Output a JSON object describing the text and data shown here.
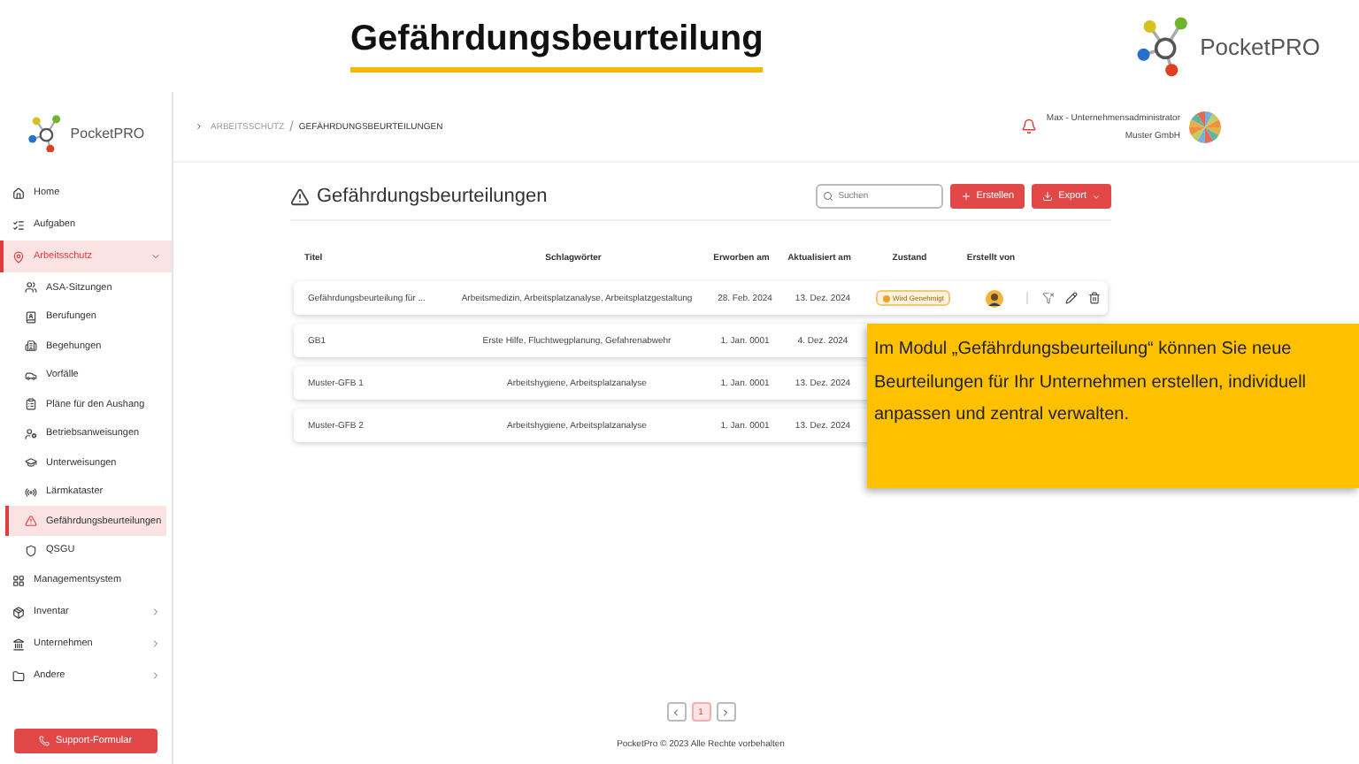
{
  "banner": {
    "title": "Gefährdungsbeurteilung",
    "logo_text": "PocketPRO"
  },
  "sidebar": {
    "logo_text": "PocketPRO",
    "items": [
      {
        "label": "Home",
        "selected": false
      },
      {
        "label": "Aufgaben",
        "selected": false
      },
      {
        "label": "Arbeitsschutz",
        "selected": true,
        "expanded": true,
        "children": [
          {
            "label": "ASA-Sitzungen",
            "selected": false
          },
          {
            "label": "Berufungen",
            "selected": false
          },
          {
            "label": "Begehungen",
            "selected": false
          },
          {
            "label": "Vorfälle",
            "selected": false
          },
          {
            "label": "Pläne für den Aushang",
            "selected": false
          },
          {
            "label": "Betriebsanweisungen",
            "selected": false
          },
          {
            "label": "Unterweisungen",
            "selected": false
          },
          {
            "label": "Lärmkataster",
            "selected": false
          },
          {
            "label": "Gefährdungsbeurteilungen",
            "selected": true
          },
          {
            "label": "QSGU",
            "selected": false
          }
        ]
      },
      {
        "label": "Managementsystem",
        "selected": false
      },
      {
        "label": "Inventar",
        "selected": false,
        "expanded": false
      },
      {
        "label": "Unternehmen",
        "selected": false,
        "expanded": false
      },
      {
        "label": "Andere",
        "selected": false,
        "expanded": false
      }
    ],
    "support_button": "Support-Formular"
  },
  "topbar": {
    "breadcrumb": [
      "ARBEITSSCHUTZ",
      "GEFÄHRDUNGSBEURTEILUNGEN"
    ],
    "breadcrumb_separator": "/",
    "user": "Max - Unternehmensadministrator",
    "company": "Muster GmbH"
  },
  "page": {
    "title": "Gefährdungsbeurteilungen",
    "search": {
      "placeholder": "Suchen"
    },
    "create_button": "Erstellen",
    "export_button": "Export"
  },
  "table": {
    "columns": [
      "Titel",
      "Schlagwörter",
      "Erworben am",
      "Aktualisiert am",
      "Zustand",
      "Erstellt von"
    ],
    "rows": [
      {
        "cells": [
          "Gefährdungsbeurteilung für ...",
          "Arbeitsmedizin, Arbeitsplatzanalyse, Arbeitsplatzgestaltung",
          "28. Feb. 2024",
          "13. Dez. 2024"
        ],
        "status": "Wird Genehmigt"
      },
      {
        "cells": [
          "GB1",
          "Erste Hilfe, Fluchtwegplanung, Gefahrenabwehr",
          "1. Jan. 0001",
          "4. Dez. 2024"
        ]
      },
      {
        "cells": [
          "Muster-GFB 1",
          "Arbeitshygiene, Arbeitsplatzanalyse",
          "1. Jan. 0001",
          "13. Dez. 2024"
        ]
      },
      {
        "cells": [
          "Muster-GFB 2",
          "Arbeitshygiene, Arbeitsplatzanalyse",
          "1. Jan. 0001",
          "13. Dez. 2024"
        ]
      }
    ]
  },
  "pagination": {
    "pages": [
      {
        "label": "1",
        "selected": true
      }
    ]
  },
  "footer": "PocketPro © 2023 Alle Rechte vorbehalten",
  "callout": "Im Modul „Gefährdungsbeurteilung“ können Sie neue Beurteilungen für Ihr Unternehmen erstellen, individuell anpassen und zentral verwalten."
}
